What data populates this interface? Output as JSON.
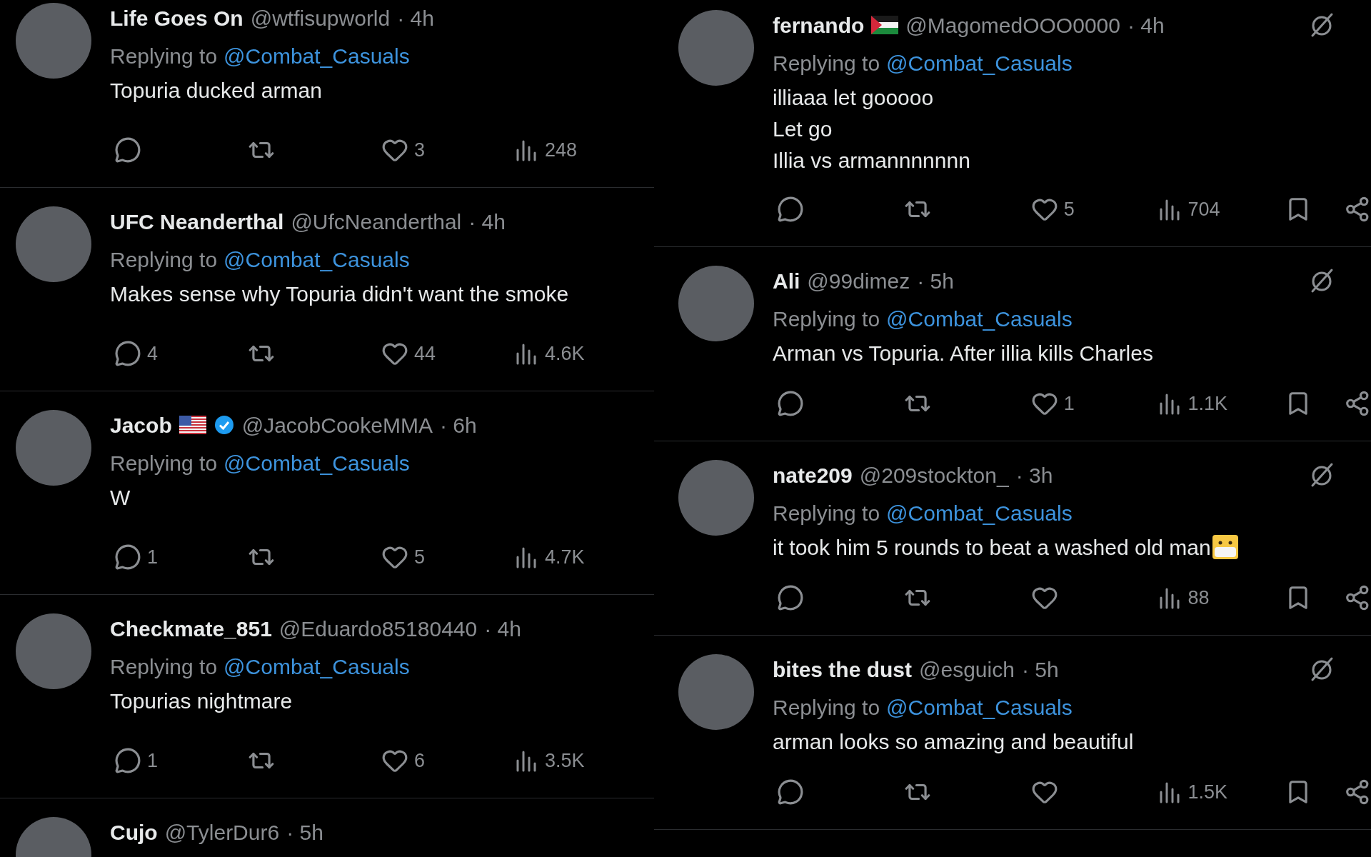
{
  "columns": [
    {
      "kind": "compact",
      "tweets": [
        {
          "name": "Life Goes On",
          "handle": "@wtfisupworld",
          "time": "· 4h",
          "replying_label": "Replying to",
          "mention": "@Combat_Casuals",
          "lines": [
            "Topuria ducked arman"
          ],
          "likes": "3",
          "views": "248"
        },
        {
          "name": "UFC Neanderthal",
          "handle": "@UfcNeanderthal",
          "time": "· 4h",
          "replying_label": "Replying to",
          "mention": "@Combat_Casuals",
          "lines": [
            "Makes sense why Topuria didn't  want the smoke"
          ],
          "replies": "4",
          "likes": "44",
          "views": "4.6K"
        },
        {
          "name": "Jacob",
          "flag": {
            "kind": "us"
          },
          "verified": true,
          "handle": "@JacobCookeMMA",
          "time": "· 6h",
          "replying_label": "Replying to",
          "mention": "@Combat_Casuals",
          "lines": [
            "W"
          ],
          "replies": "1",
          "likes": "5",
          "views": "4.7K"
        },
        {
          "name": "Checkmate_851",
          "handle": "@Eduardo85180440",
          "time": "· 4h",
          "replying_label": "Replying to",
          "mention": "@Combat_Casuals",
          "lines": [
            "Topurias nightmare"
          ],
          "replies": "1",
          "likes": "6",
          "views": "3.5K"
        },
        {
          "name": "Cujo",
          "handle": "@TylerDur6",
          "time": "· 5h"
        }
      ]
    },
    {
      "kind": "full",
      "tweets": [
        {
          "name": "fernando",
          "flag": {
            "kind": "ps"
          },
          "handle": "@MagomedOOO0000",
          "time": "· 4h",
          "replying_label": "Replying to",
          "mention": "@Combat_Casuals",
          "lines": [
            "illiaaa let gooooo",
            "Let go",
            "Illia vs armannnnnnn"
          ],
          "likes": "5",
          "views": "704"
        },
        {
          "name": "Ali",
          "handle": "@99dimez",
          "time": "· 5h",
          "replying_label": "Replying to",
          "mention": "@Combat_Casuals",
          "lines": [
            "Arman vs Topuria. After illia kills Charles"
          ],
          "likes": "1",
          "views": "1.1K"
        },
        {
          "name": "nate209",
          "handle": "@209stockton_",
          "time": "· 3h",
          "replying_label": "Replying to",
          "mention": "@Combat_Casuals",
          "lines": [
            "it took him 5 rounds to beat a washed old man"
          ],
          "emoji": {
            "kind": "mask"
          },
          "views": "88"
        },
        {
          "name": "bites the dust",
          "handle": "@esguich",
          "time": "· 5h",
          "replying_label": "Replying to",
          "mention": "@Combat_Casuals",
          "lines": [
            "arman looks so amazing and beautiful"
          ],
          "views": "1.5K"
        }
      ]
    }
  ]
}
